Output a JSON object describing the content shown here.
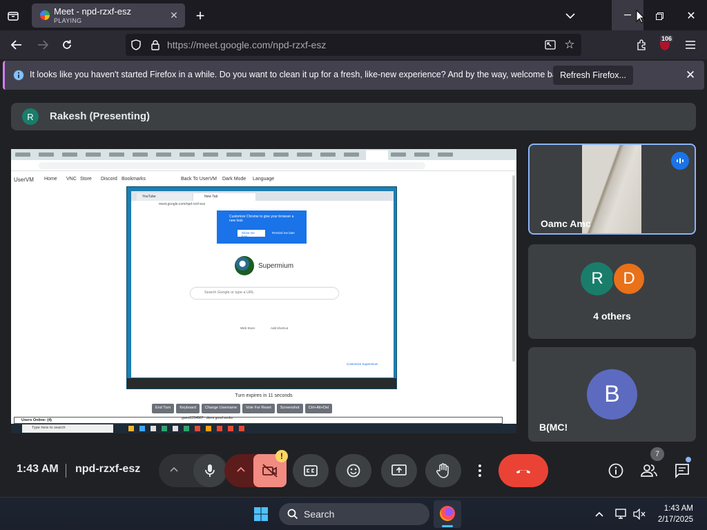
{
  "browser": {
    "tab": {
      "title": "Meet - npd-rzxf-esz",
      "subtitle": "PLAYING"
    },
    "url": "https://meet.google.com/npd-rzxf-esz",
    "extension_badge": "106"
  },
  "notification": {
    "text": "It looks like you haven't started Firefox in a while. Do you want to clean it up for a fresh, like-new experience? And by the way, welcome back!",
    "button": "Refresh Firefox..."
  },
  "meet": {
    "presenter": {
      "initial": "R",
      "label": "Rakesh (Presenting)"
    },
    "participants": [
      {
        "name": "Oamc Amc"
      },
      {
        "initials": [
          "R",
          "D"
        ],
        "label": "4 others"
      },
      {
        "initial": "B",
        "name": "B(MC!"
      }
    ],
    "shared_screen": {
      "site_name": "UserVM",
      "bookmarks": [
        "Home",
        "VNC",
        "Store",
        "Discord",
        "Bookmarks",
        "Back To UserVM",
        "Dark Mode",
        "Language"
      ],
      "inner_tabs": [
        "YouTube",
        "New Tab"
      ],
      "inner_url": "meet.google.com/npd-rzxf-esz",
      "popup_title": "Customize Chrome to give your browser a new look",
      "popup_buttons": [
        "Show me how",
        "Remind me later"
      ],
      "logo_text": "Supermium",
      "search_placeholder": "Search Google or type a URL",
      "shortcuts": [
        "Web Store",
        "Add shortcut"
      ],
      "customize": "Customize Supermium",
      "turn_text": "Turn expires in 11 seconds",
      "action_buttons": [
        "End Turn",
        "Keyboard",
        "Change Username",
        "Vote For Reset",
        "Screenshot",
        "Ctrl+Alt+Del"
      ],
      "users_online": "Users Online: (4)",
      "chat_text": "guest1234567 : dorm good socks",
      "host_search": "Type here to search"
    },
    "controls": {
      "time": "1:43 AM",
      "code": "npd-rzxf-esz",
      "warning": "!",
      "people_count": "7"
    }
  },
  "taskbar": {
    "search": "Search",
    "time": "1:43 AM",
    "date": "2/17/2025"
  },
  "colors": {
    "meet_bg": "#202124",
    "tile_bg": "#3c4043",
    "end_call": "#ea4335",
    "accent_blue": "#8ab4f8"
  }
}
